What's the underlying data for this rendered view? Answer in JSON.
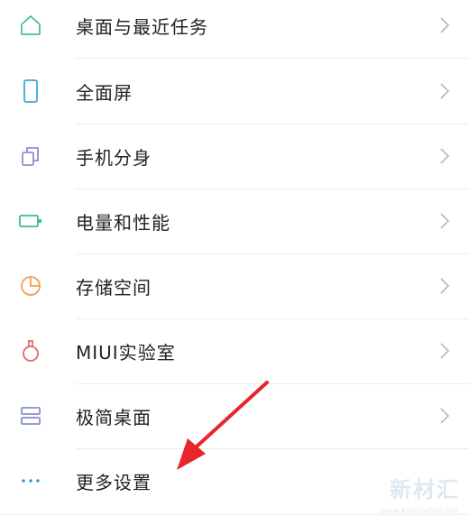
{
  "settings": {
    "items": [
      {
        "label": "桌面与最近任务",
        "icon": "home-icon"
      },
      {
        "label": "全面屏",
        "icon": "phone-screen-icon"
      },
      {
        "label": "手机分身",
        "icon": "clone-icon"
      },
      {
        "label": "电量和性能",
        "icon": "battery-icon"
      },
      {
        "label": "存储空间",
        "icon": "storage-pie-icon"
      },
      {
        "label": "MIUI实验室",
        "icon": "flask-icon"
      },
      {
        "label": "极简桌面",
        "icon": "simple-desktop-icon"
      },
      {
        "label": "更多设置",
        "icon": "more-dots-icon"
      }
    ]
  },
  "watermark": {
    "text": "新材汇",
    "url": "www.xiancaihui.net"
  },
  "colors": {
    "home_icon": "#4fb8a4",
    "screen_icon": "#3aa8d8",
    "clone_icon": "#9a8ac8",
    "battery_icon": "#3cb89a",
    "storage_icon": "#f0a050",
    "flask_icon": "#e06a6a",
    "simple_icon": "#8a8fd0",
    "more_icon": "#3a9ad8",
    "arrow": "#e8262a"
  }
}
